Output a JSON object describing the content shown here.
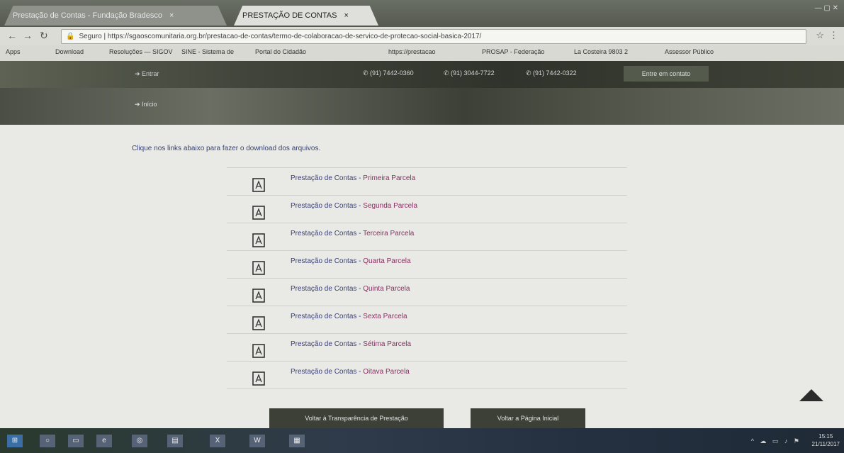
{
  "browser": {
    "tabs": [
      {
        "label": "Prestação de Contas - Fundação Bradesco",
        "active": false
      },
      {
        "label": "PRESTAÇÃO DE CONTAS",
        "active": true
      }
    ],
    "back_icon": "back-arrow-icon",
    "forward_icon": "forward-arrow-icon",
    "reload_icon": "reload-icon",
    "security_label": "Seguro",
    "url": "https://sgaoscomunitaria.org.br/prestacao-de-contas/termo-de-colaboracao-de-servico-de-protecao-social-basica-2017/",
    "bookmark_icon": "star-icon"
  },
  "bookmarks": [
    {
      "label": "Apps"
    },
    {
      "label": "Download"
    },
    {
      "label": "Resoluções — SIGOV"
    },
    {
      "label": "SINE - Sistema de"
    },
    {
      "label": "Portal do Cidadão"
    },
    {
      "label": "https://prestacao"
    },
    {
      "label": "PROSAP - Federação"
    },
    {
      "label": "La Costeira 9803 2"
    },
    {
      "label": "Assessor Público"
    }
  ],
  "header": {
    "login_label": "Entrar",
    "phones": [
      "(91) 7442-0360",
      "(91) 3044-7722",
      "(91) 7442-0322"
    ],
    "contact_button": "Entre em contato",
    "nav_label": "Início"
  },
  "content": {
    "intro": "Clique nos links abaixo para fazer o download dos arquivos.",
    "doc_prefix": "Prestação de Contas",
    "separator": " - ",
    "documents": [
      "Primeira Parcela",
      "Segunda Parcela",
      "Terceira Parcela",
      "Quarta Parcela",
      "Quinta Parcela",
      "Sexta Parcela",
      "Sétima Parcela",
      "Oitava Parcela"
    ]
  },
  "footer": {
    "buttons": [
      "Voltar à Transparência de Prestação",
      "Voltar a Página Inicial"
    ]
  },
  "taskbar": {
    "clock_time": "15:15",
    "clock_date": "21/11/2017"
  }
}
